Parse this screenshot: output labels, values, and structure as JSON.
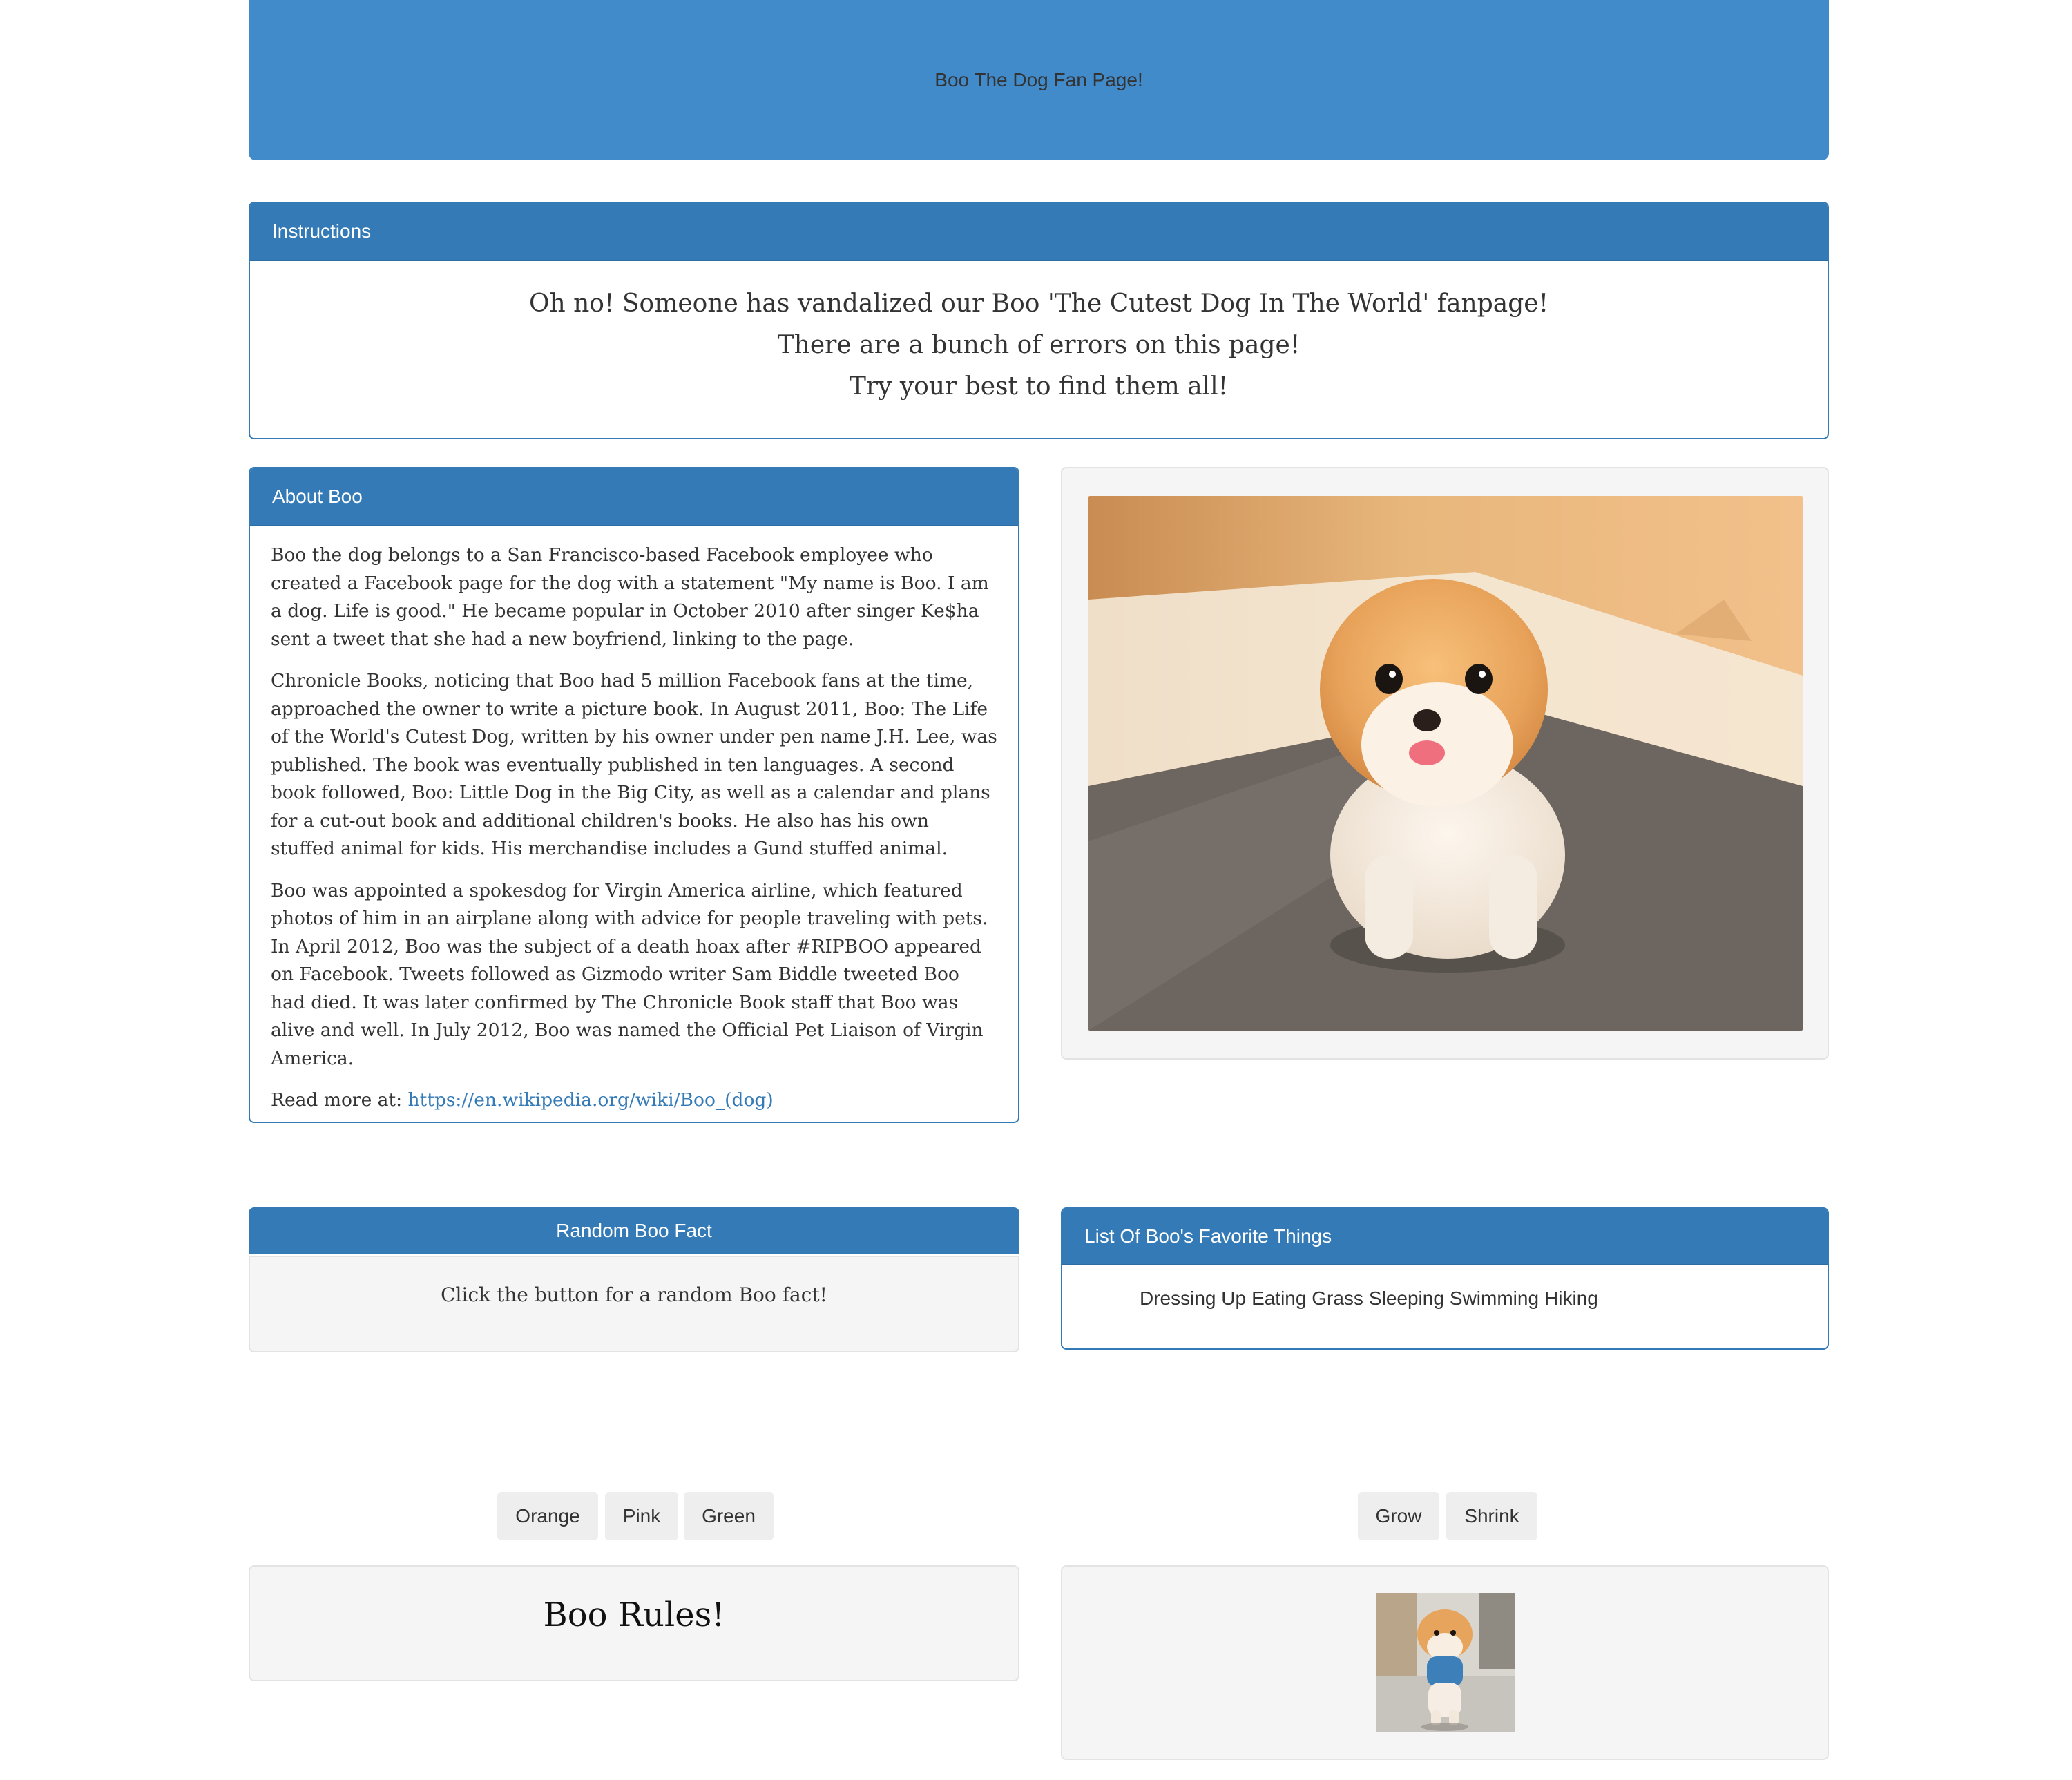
{
  "header": {
    "title": "Boo The Dog Fan Page!"
  },
  "instructions": {
    "heading": "Instructions",
    "lines": [
      "Oh no! Someone has vandalized our Boo 'The Cutest Dog In The World' fanpage!",
      "There are a bunch of errors on this page!",
      "Try your best to find them all!"
    ]
  },
  "about": {
    "heading": "About Boo",
    "paragraphs": [
      "Boo the dog belongs to a San Francisco-based Facebook employee who created a Facebook page for the dog with a statement \"My name is Boo. I am a dog. Life is good.\" He became popular in October 2010 after singer Ke$ha sent a tweet that she had a new boyfriend, linking to the page.",
      "Chronicle Books, noticing that Boo had 5 million Facebook fans at the time, approached the owner to write a picture book. In August 2011, Boo: The Life of the World's Cutest Dog, written by his owner under pen name J.H. Lee, was published. The book was eventually published in ten languages. A second book followed, Boo: Little Dog in the Big City, as well as a calendar and plans for a cut-out book and additional children's books. He also has his own stuffed animal for kids. His merchandise includes a Gund stuffed animal.",
      "Boo was appointed a spokesdog for Virgin America airline, which featured photos of him in an airplane along with advice for people traveling with pets. In April 2012, Boo was the subject of a death hoax after #RIPBOO appeared on Facebook. Tweets followed as Gizmodo writer Sam Biddle tweeted Boo had died. It was later confirmed by The Chronicle Book staff that Boo was alive and well. In July 2012, Boo was named the Official Pet Liaison of Virgin America."
    ],
    "read_more_label": "Read more at:",
    "read_more_link": "https://en.wikipedia.org/wiki/Boo_(dog)"
  },
  "random_fact": {
    "heading": "Random Boo Fact",
    "text": "Click the button for a random Boo fact!"
  },
  "favorites": {
    "heading": "List Of Boo's Favorite Things",
    "items": [
      "Dressing Up",
      "Eating Grass",
      "Sleeping",
      "Swimming",
      "Hiking"
    ]
  },
  "color_buttons": [
    "Orange",
    "Pink",
    "Green"
  ],
  "size_buttons": [
    "Grow",
    "Shrink"
  ],
  "rules_text": "Boo Rules!",
  "colors": {
    "jumbotron": "#428bca",
    "panel_primary": "#337ab7",
    "well": "#f5f5f5",
    "button": "#eeeeee",
    "link": "#337ab7"
  },
  "icons": {
    "main_photo": "pomeranian-dog-photo",
    "small_photo": "pomeranian-dog-street-photo"
  }
}
